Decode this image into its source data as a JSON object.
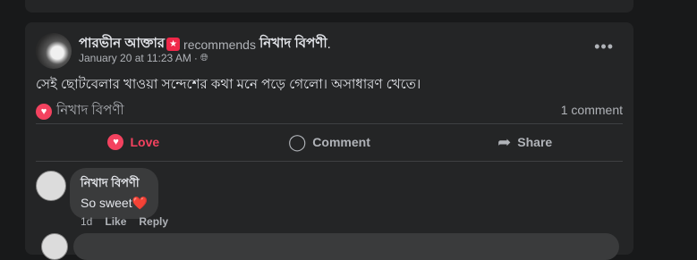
{
  "post": {
    "author": "পারভীন আক্তার",
    "badge_icon": "star-badge-icon",
    "recommends_label": "recommends",
    "page_name": "নিখাদ বিপণী",
    "page_name_suffix": ".",
    "timestamp": "January 20 at 11:23 AM",
    "separator": "·",
    "privacy_icon": "globe-icon",
    "more_label": "•••",
    "text": "সেই ছোটবেলার খাওয়া সন্দেশের কথা মনে পড়ে গেলো। অসাধারণ খেতে।"
  },
  "recommendation": {
    "icon": "heart-icon",
    "page_name": "নিখাদ বিপণী",
    "comment_count": "1 comment"
  },
  "actions": {
    "love_label": "Love",
    "comment_label": "Comment",
    "share_label": "Share"
  },
  "comments": [
    {
      "author": "নিখাদ বিপণী",
      "text": "So sweet",
      "emoji": "❤️",
      "time": "1d",
      "like_label": "Like",
      "reply_label": "Reply"
    }
  ],
  "colors": {
    "background": "#18191a",
    "card": "#242526",
    "love_red": "#f3425f",
    "secondary_text": "#b0b3b8"
  }
}
